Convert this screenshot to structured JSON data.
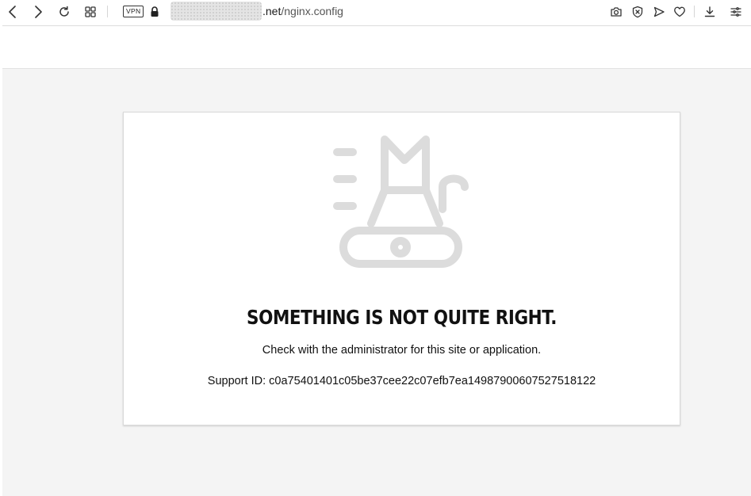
{
  "browser": {
    "url_domain_suffix": ".net",
    "url_path": "/nginx.config",
    "vpn_label": "VPN",
    "icons": {
      "back": "chevron-left-icon",
      "forward": "chevron-right-icon",
      "reload": "reload-icon",
      "tabs": "grid-icon",
      "lock": "lock-icon",
      "snapshot": "camera-icon",
      "adblock": "shield-x-icon",
      "send": "send-icon",
      "bookmark": "heart-icon",
      "download": "download-icon",
      "menu": "menu-icon"
    }
  },
  "error_page": {
    "headline": "SOMETHING IS NOT QUITE RIGHT.",
    "message": "Check with the administrator for this site or application.",
    "support_id": "Support ID: c0a75401401c05be37cee22c07efb7ea14987900607527518122",
    "illustration": "cat-on-skateboard-icon",
    "illustration_color": "#dcdcdc"
  }
}
